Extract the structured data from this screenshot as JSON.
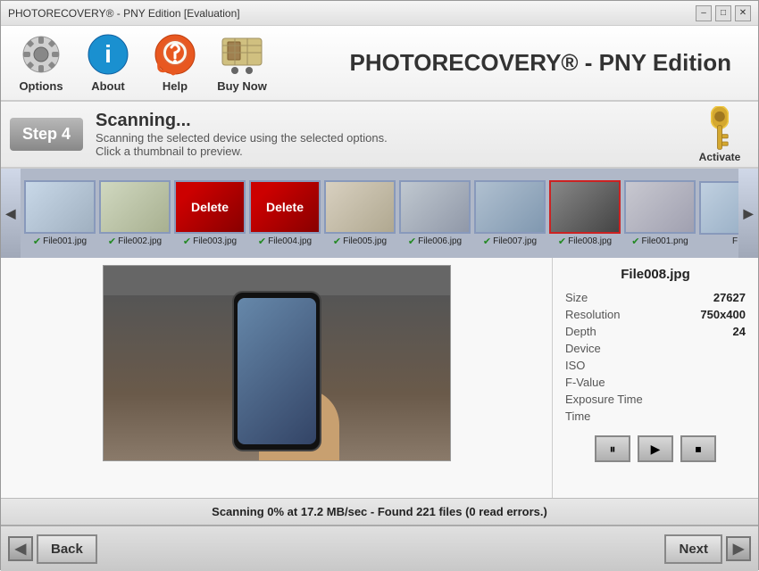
{
  "window": {
    "title": "PHOTORECOVERY® - PNY Edition [Evaluation]",
    "controls": [
      "–",
      "□",
      "✕"
    ]
  },
  "toolbar": {
    "title": "PHOTORECOVERY® - PNY Edition",
    "buttons": [
      {
        "id": "options",
        "label": "Options"
      },
      {
        "id": "about",
        "label": "About"
      },
      {
        "id": "help",
        "label": "Help"
      },
      {
        "id": "buynow",
        "label": "Buy Now"
      }
    ]
  },
  "step": {
    "label": "Step 4",
    "heading": "Scanning...",
    "line1": "Scanning the selected device using the selected options.",
    "line2": "Click a thumbnail to preview.",
    "activate_label": "Activate"
  },
  "thumbnails": [
    {
      "label": "File001.jpg",
      "checked": true,
      "style": "t1"
    },
    {
      "label": "File002.jpg",
      "checked": true,
      "style": "t2"
    },
    {
      "label": "File003.jpg",
      "checked": true,
      "style": "t3"
    },
    {
      "label": "File004.jpg",
      "checked": true,
      "style": "t4"
    },
    {
      "label": "File005.jpg",
      "checked": true,
      "style": "t5"
    },
    {
      "label": "File006.jpg",
      "checked": true,
      "style": "t6"
    },
    {
      "label": "File007.jpg",
      "checked": true,
      "style": "t7"
    },
    {
      "label": "File008.jpg",
      "checked": true,
      "style": "t8",
      "selected": true
    },
    {
      "label": "File001.png",
      "checked": true,
      "style": "t9"
    },
    {
      "label": "F",
      "checked": false,
      "style": "t10"
    }
  ],
  "preview": {
    "filename": "File008.jpg",
    "info": [
      {
        "key": "Size",
        "value": "27627"
      },
      {
        "key": "Resolution",
        "value": "750x400"
      },
      {
        "key": "Depth",
        "value": "24"
      },
      {
        "key": "Device",
        "value": ""
      },
      {
        "key": "ISO",
        "value": ""
      },
      {
        "key": "F-Value",
        "value": ""
      },
      {
        "key": "Exposure Time",
        "value": ""
      },
      {
        "key": "Time",
        "value": ""
      }
    ]
  },
  "status": {
    "text": "Scanning 0% at 17.2 MB/sec - Found 221 files (0 read errors.)"
  },
  "navigation": {
    "back_label": "Back",
    "next_label": "Next"
  },
  "colors": {
    "accent": "#b8b8b8",
    "selected_thumb_border": "#cc2222"
  }
}
